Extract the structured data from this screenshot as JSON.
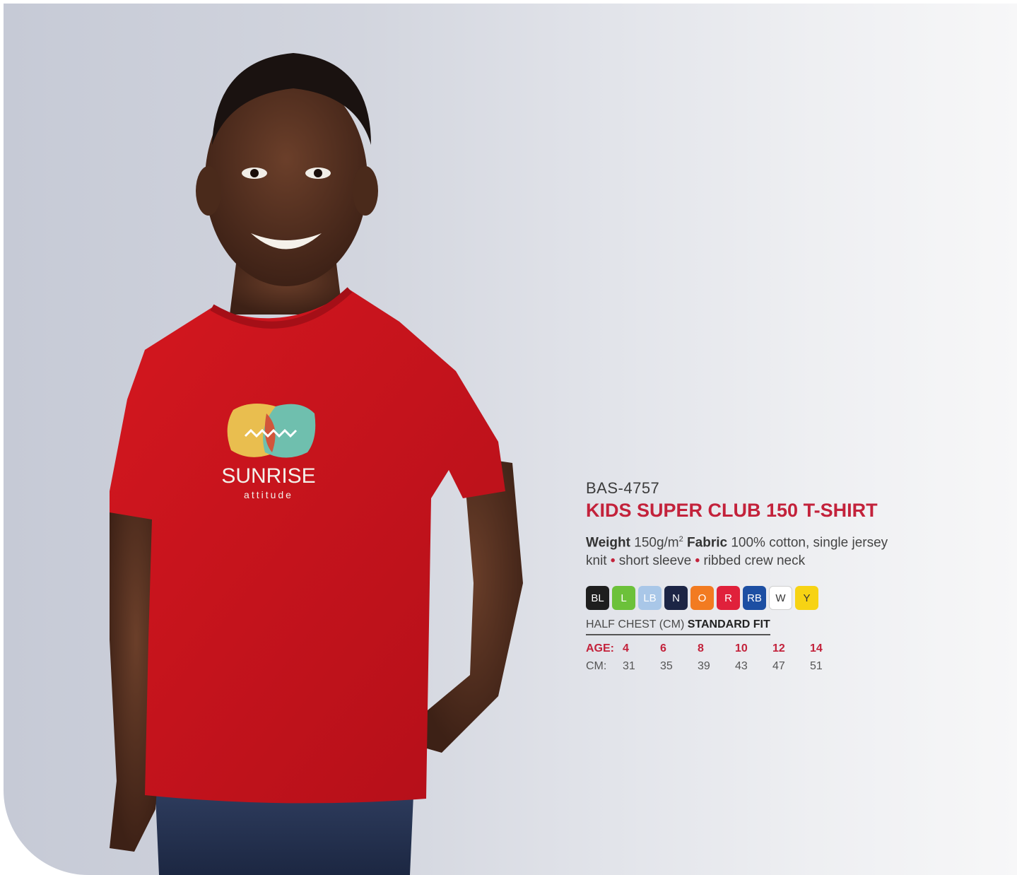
{
  "product": {
    "code": "BAS-4757",
    "title": "KIDS SUPER CLUB 150 T-SHIRT",
    "weight_label": "Weight",
    "weight_value": "150g/m",
    "weight_sup": "2",
    "fabric_label": "Fabric",
    "fabric_value": "100% cotton, single jersey knit",
    "feature_1": "short sleeve",
    "feature_2": "ribbed crew neck",
    "bullet": "•"
  },
  "photo": {
    "shirt_logo_line1": "SUNRISE",
    "shirt_logo_line2": "attitude"
  },
  "colours": [
    {
      "code": "BL",
      "hex": "#1e1e1e"
    },
    {
      "code": "L",
      "hex": "#6cc13a"
    },
    {
      "code": "LB",
      "hex": "#a9c7e8"
    },
    {
      "code": "N",
      "hex": "#1c2545"
    },
    {
      "code": "O",
      "hex": "#f27b21"
    },
    {
      "code": "R",
      "hex": "#e0213b"
    },
    {
      "code": "RB",
      "hex": "#1d4fa3"
    },
    {
      "code": "W",
      "hex": "#ffffff"
    },
    {
      "code": "Y",
      "hex": "#f7d314"
    }
  ],
  "sizes": {
    "heading_prefix": "HALF CHEST (CM)",
    "heading_fit": "STANDARD FIT",
    "age_label": "AGE:",
    "cm_label": "CM:",
    "ages": [
      "4",
      "6",
      "8",
      "10",
      "12",
      "14"
    ],
    "cms": [
      "31",
      "35",
      "39",
      "43",
      "47",
      "51"
    ]
  },
  "accent_color": "#c3223b"
}
